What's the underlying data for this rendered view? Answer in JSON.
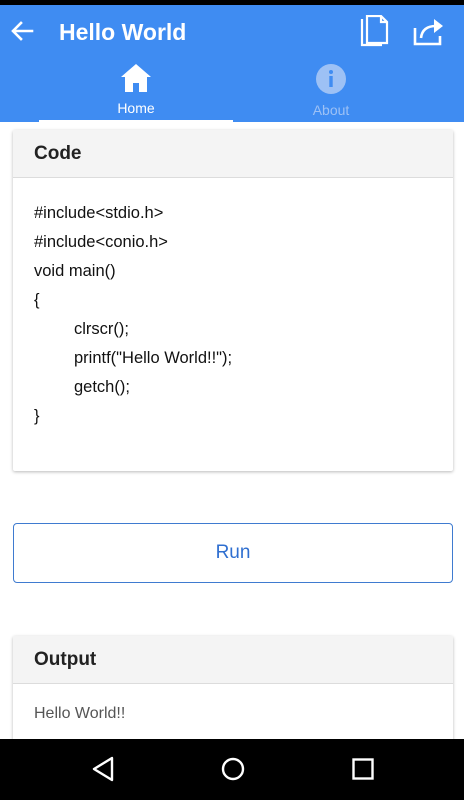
{
  "app": {
    "title": "Hello World"
  },
  "tabs": [
    {
      "label": "Home",
      "icon": "home-icon",
      "active": true
    },
    {
      "label": "About",
      "icon": "info-icon",
      "active": false
    }
  ],
  "code_card": {
    "title": "Code",
    "lines": [
      "#include<stdio.h>",
      "#include<conio.h>",
      "void main()",
      "{",
      "clrscr();",
      "printf(\"Hello World!!\");",
      "getch();",
      "}"
    ]
  },
  "run_button": {
    "label": "Run"
  },
  "output_card": {
    "title": "Output",
    "text": "Hello World!!"
  },
  "colors": {
    "app_bar": "#3f8cf2",
    "button_accent": "#2f6fd0"
  }
}
